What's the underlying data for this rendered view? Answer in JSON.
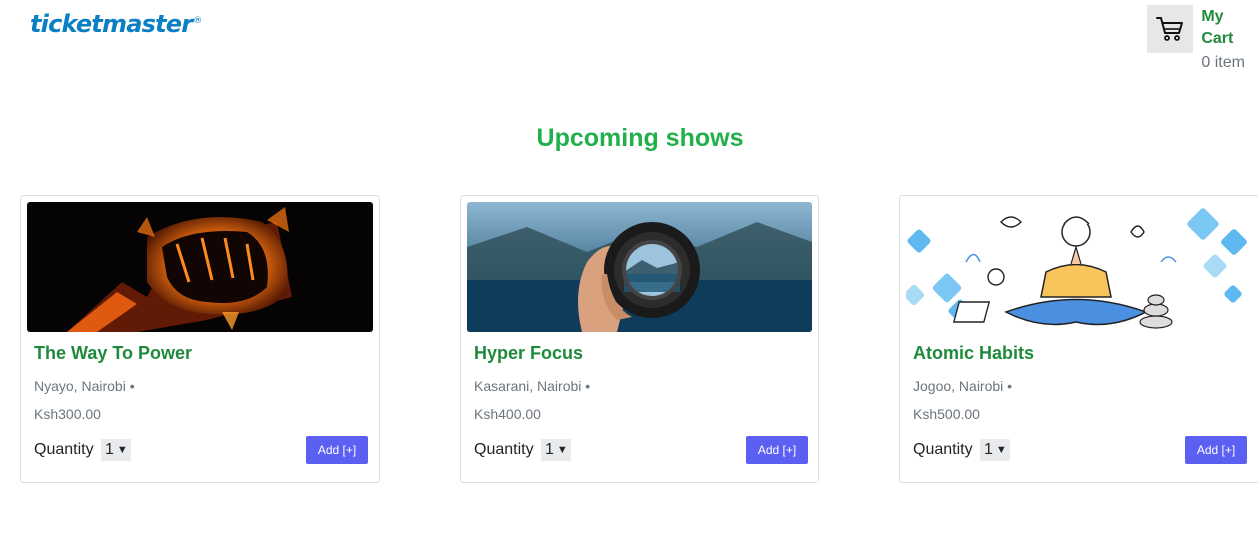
{
  "brand": {
    "logo_text": "ticketmaster",
    "registered_mark": "®",
    "color": "#0a7fc4"
  },
  "cart": {
    "title": "My Cart",
    "count_text": "0 item",
    "icon": "shopping-cart-icon"
  },
  "page": {
    "section_title": "Upcoming shows"
  },
  "shows": [
    {
      "title": "The Way To Power",
      "location": "Nyayo, Nairobi •",
      "price": "Ksh300.00",
      "quantity_label": "Quantity",
      "quantity_value": "1",
      "add_label": "Add [+]",
      "image": "flaming-fist-image"
    },
    {
      "title": "Hyper Focus",
      "location": "Kasarani, Nairobi •",
      "price": "Ksh400.00",
      "quantity_label": "Quantity",
      "quantity_value": "1",
      "add_label": "Add [+]",
      "image": "camera-lens-lake-image"
    },
    {
      "title": "Atomic Habits",
      "location": "Jogoo, Nairobi •",
      "price": "Ksh500.00",
      "quantity_label": "Quantity",
      "quantity_value": "1",
      "add_label": "Add [+]",
      "image": "meditation-illustration-image"
    }
  ],
  "colors": {
    "accent_green": "#22b04b",
    "title_green": "#1f8a3c",
    "button_blue": "#5b5ff2"
  }
}
